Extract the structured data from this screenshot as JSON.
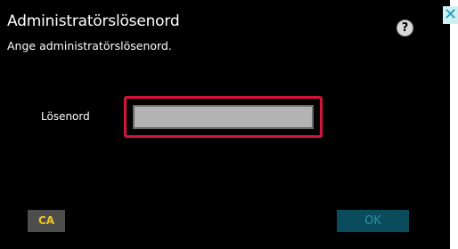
{
  "dialog": {
    "title": "Administratörslösenord",
    "subtitle": "Ange administratörslösenord.",
    "help_label": "?",
    "close_label": "✕"
  },
  "form": {
    "password_label": "Lösenord",
    "password_value": ""
  },
  "footer": {
    "ca_label": "CA",
    "ok_label": "OK"
  },
  "colors": {
    "background": "#000000",
    "focus_border": "#d4143a",
    "input_fill": "#b3b3b3",
    "ca_text": "#f5c518",
    "ok_disabled_bg": "#0a4b5c"
  }
}
